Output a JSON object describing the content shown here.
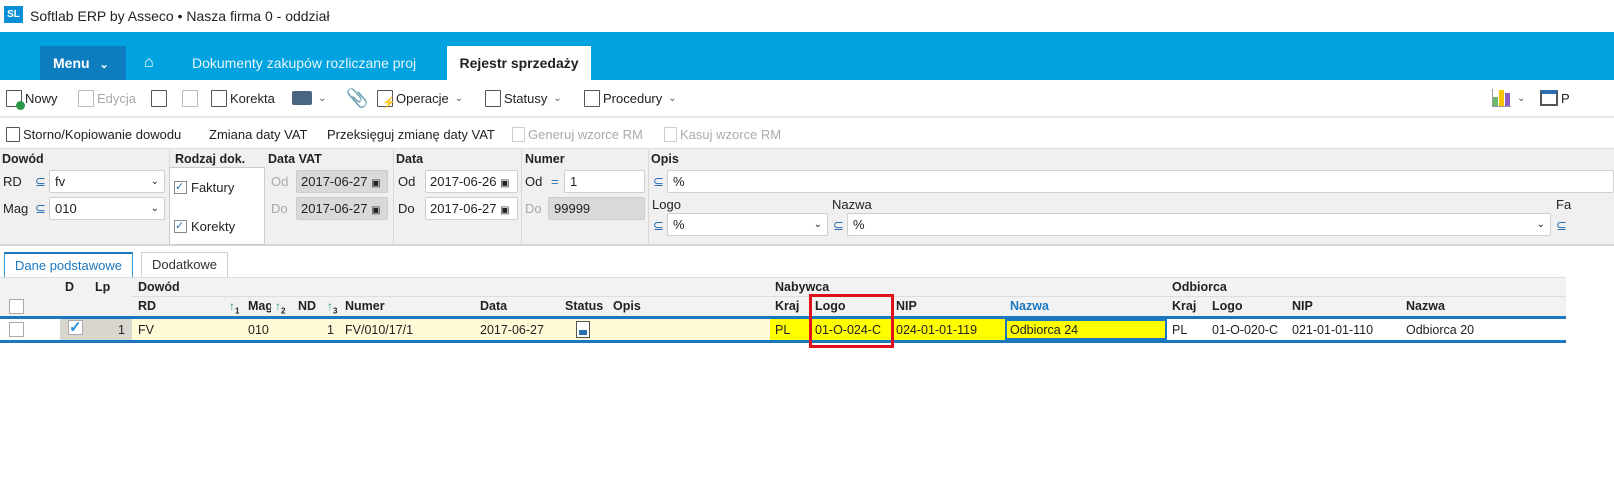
{
  "app": {
    "logo": "SL",
    "title": "Softlab ERP by Asseco • Nasza firma 0 - oddział"
  },
  "nav": {
    "menu": "Menu",
    "home_icon": "home-icon",
    "tabs": [
      "Dokumenty zakupów rozliczane proj",
      "Rejestr sprzedaży"
    ]
  },
  "toolbar": {
    "nowy": "Nowy",
    "edycja": "Edycja",
    "korekta": "Korekta",
    "operacje": "Operacje",
    "statusy": "Statusy",
    "procedury": "Procedury",
    "right_partial": "P"
  },
  "toolbar2": {
    "storno": "Storno/Kopiowanie dowodu",
    "zmiana": "Zmiana daty VAT",
    "przeksieguj": "Przeksięguj zmianę daty VAT",
    "generuj": "Generuj wzorce RM",
    "kasuj": "Kasuj wzorce RM"
  },
  "filter": {
    "dowod": {
      "label": "Dowód",
      "rd_label": "RD",
      "rd_value": "fv",
      "mag_label": "Mag",
      "mag_value": "010"
    },
    "rodzaj": {
      "label": "Rodzaj dok.",
      "faktury": "Faktury",
      "korekty": "Korekty",
      "faktury_checked": true,
      "korekty_checked": true
    },
    "data_vat": {
      "label": "Data VAT",
      "od": "Od",
      "od_value": "2017-06-27",
      "do": "Do",
      "do_value": "2017-06-27"
    },
    "data": {
      "label": "Data",
      "od": "Od",
      "od_value": "2017-06-26",
      "do": "Do",
      "do_value": "2017-06-27"
    },
    "numer": {
      "label": "Numer",
      "od": "Od",
      "eq": "=",
      "od_value": "1",
      "do": "Do",
      "do_value": "99999"
    },
    "opis": {
      "label": "Opis",
      "value": "%"
    },
    "logo": {
      "label": "Logo",
      "value": "%"
    },
    "nazwa": {
      "label": "Nazwa",
      "value": "%"
    },
    "fa_partial": "Fa",
    "subset_symbol": "⊆"
  },
  "grid_tabs": [
    "Dane podstawowe",
    "Dodatkowe"
  ],
  "grid": {
    "groups": {
      "d": "D",
      "lp": "Lp",
      "dowod": "Dowód",
      "nabywca": "Nabywca",
      "odbiorca": "Odbiorca"
    },
    "columns": {
      "rd": "RD",
      "mag": "Mag",
      "nd": "ND",
      "numer": "Numer",
      "data": "Data",
      "status": "Status",
      "opis": "Opis",
      "n_kraj": "Kraj",
      "n_logo": "Logo",
      "n_nip": "NIP",
      "n_nazwa": "Nazwa",
      "o_kraj": "Kraj",
      "o_logo": "Logo",
      "o_nip": "NIP",
      "o_nazwa": "Nazwa"
    },
    "sort": [
      "1",
      "2",
      "3"
    ],
    "rows": [
      {
        "d": true,
        "lp": "1",
        "rd": "FV",
        "mag": "010",
        "nd": "1",
        "numer": "FV/010/17/1",
        "data": "2017-06-27",
        "status_icon": "document-icon",
        "opis": "",
        "n_kraj": "PL",
        "n_logo": "01-O-024-C",
        "n_nip": "024-01-01-119",
        "n_nazwa": "Odbiorca 24",
        "o_kraj": "PL",
        "o_logo": "01-O-020-C",
        "o_nip": "021-01-01-110",
        "o_nazwa": "Odbiorca 20"
      }
    ]
  },
  "colors": {
    "brand": "#00a2e0",
    "menu": "#0e7dc0",
    "highlight": "#ffff00",
    "annotation": "#e0101a"
  }
}
